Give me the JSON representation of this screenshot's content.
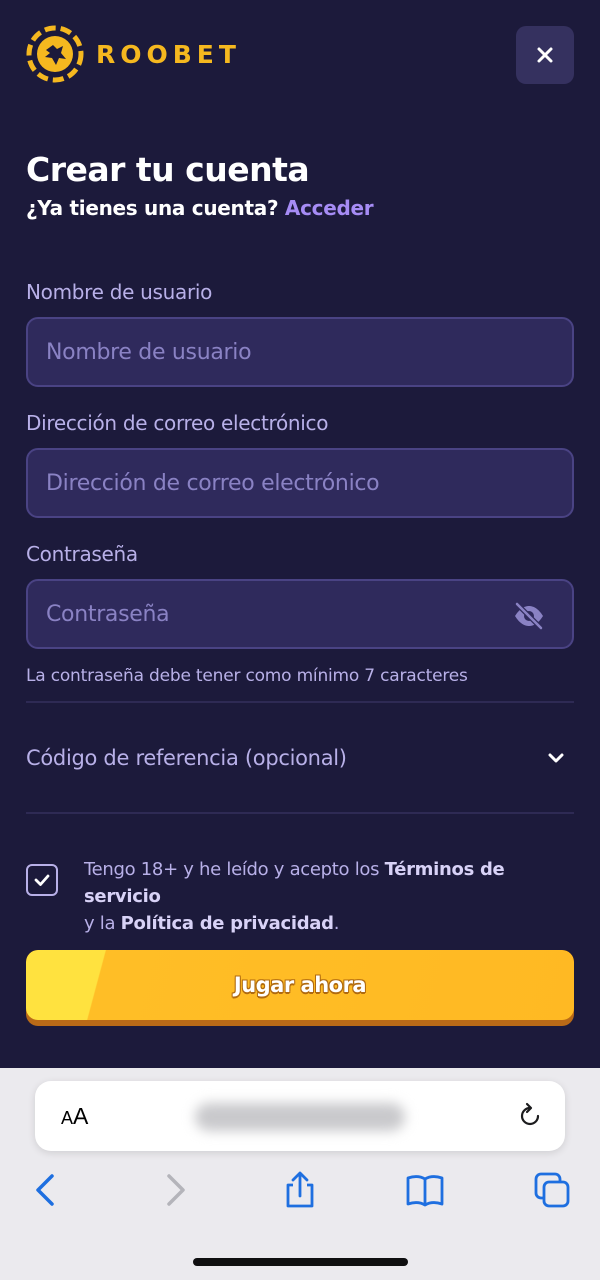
{
  "header": {
    "brand_name": "ROOBET",
    "close_icon": "close-icon",
    "colors": {
      "brand": "#f5b81f",
      "background": "#1c1a3b",
      "close_bg": "#35315f"
    }
  },
  "title": "Crear tu cuenta",
  "login_prompt": {
    "question": "¿Ya tienes una cuenta?",
    "link": "Acceder"
  },
  "form": {
    "username": {
      "label": "Nombre de usuario",
      "placeholder": "Nombre de usuario",
      "value": ""
    },
    "email": {
      "label": "Dirección de correo electrónico",
      "placeholder": "Dirección de correo electrónico",
      "value": ""
    },
    "password": {
      "label": "Contraseña",
      "placeholder": "Contraseña",
      "value": "",
      "visibility_icon": "eye-off-icon"
    },
    "password_hint": "La contraseña debe tener como mínimo 7 caracteres",
    "referral": {
      "label": "Código de referencia (opcional)",
      "icon": "chevron-down-icon"
    },
    "terms": {
      "checked": true,
      "prefix": "Tengo 18+ y he leído y acepto los ",
      "terms_link": "Términos de servicio",
      "middle": " y la ",
      "privacy_link": "Política de privacidad",
      "suffix": "."
    },
    "submit_label": "Jugar ahora",
    "accent_colors": {
      "link": "#a68cf5",
      "button": "#ffb923",
      "button_highlight": "#ffe23f"
    }
  },
  "browser": {
    "text_size_button": {
      "large": "A",
      "small": "A"
    },
    "icons": [
      "reload-icon",
      "back-icon",
      "forward-icon",
      "share-icon",
      "bookmarks-icon",
      "tabs-icon"
    ],
    "tint": "#1e6fe0"
  }
}
